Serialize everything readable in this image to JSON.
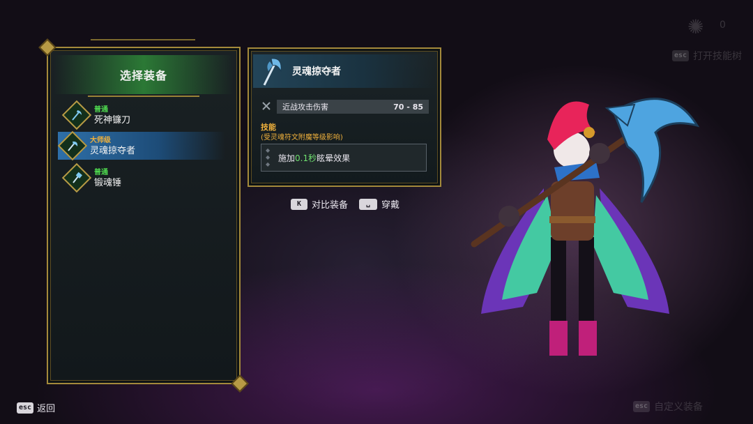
{
  "top_right": {
    "counter": "0",
    "key": "esc",
    "open_skill_tree": "打开技能树"
  },
  "bottom_right": {
    "key": "esc",
    "customize": "自定义装备"
  },
  "list_panel": {
    "title": "选择装备",
    "items": [
      {
        "rarity": "普通",
        "name": "死神镰刀",
        "selected": false
      },
      {
        "rarity": "大师级",
        "name": "灵魂掠夺者",
        "selected": true
      },
      {
        "rarity": "普通",
        "name": "锻魂锤",
        "selected": false
      }
    ]
  },
  "detail": {
    "title": "灵魂掠夺者",
    "stat_label": "近战攻击伤害",
    "stat_value": "70 - 85",
    "skill_label": "技能",
    "skill_note": "(受灵魂符文附魔等级影响)",
    "skill_prefix": "施加",
    "skill_highlight": "0.1秒",
    "skill_suffix": "眩晕效果"
  },
  "actions": {
    "compare_key": "K",
    "compare_label": "对比装备",
    "equip_key": "␣",
    "equip_label": "穿戴"
  },
  "back": {
    "key": "esc",
    "label": "返回"
  },
  "colors": {
    "gold": "#a48a3b",
    "rarity_common": "#4fd94f",
    "rarity_master": "#f0b13c",
    "selected": "#2e6fa8"
  },
  "icons": {
    "weapon": "scythe-icon",
    "stat": "crossed-swords-icon"
  }
}
